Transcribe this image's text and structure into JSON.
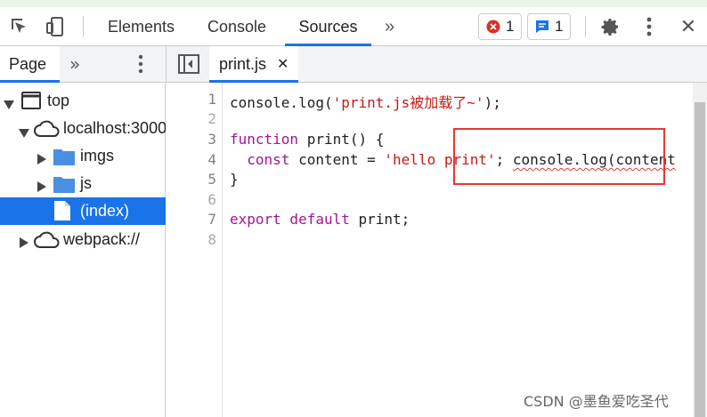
{
  "toolbar": {
    "tabs": [
      "Elements",
      "Console",
      "Sources"
    ],
    "active_tab": "Sources",
    "more_tabs_label": "»",
    "errors_count": "1",
    "messages_count": "1",
    "close_label": "✕"
  },
  "subbar": {
    "page_tab": "Page",
    "more_label": "»",
    "open_file_tab": "print.js",
    "close_file_label": "✕"
  },
  "tree": {
    "items": [
      {
        "label": "top",
        "icon": "window-icon",
        "expanded": true
      },
      {
        "label": "localhost:3000",
        "icon": "cloud-icon",
        "expanded": true
      },
      {
        "label": "imgs",
        "icon": "folder-icon",
        "expanded": false
      },
      {
        "label": "js",
        "icon": "folder-icon",
        "expanded": false
      },
      {
        "label": "(index)",
        "icon": "file-icon",
        "selected": true
      },
      {
        "label": "webpack://",
        "icon": "cloud-icon",
        "expanded": false
      }
    ]
  },
  "editor": {
    "line_numbers": [
      "1",
      "2",
      "3",
      "4",
      "5",
      "6",
      "7",
      "8"
    ],
    "lines": {
      "l1_a": "console.log(",
      "l1_str": "'print.js被加载了~'",
      "l1_b": ");",
      "l3_kw": "function",
      "l3_rest": " print() {",
      "l4_kw": "  const",
      "l4_a": " content = ",
      "l4_str": "'hello print'",
      "l4_b": "; ",
      "l4_err": "console.log(content",
      "l5": "}",
      "l7_kw1": "export",
      "l7_kw2": " default",
      "l7_rest": " print;"
    }
  },
  "watermark": "CSDN @墨鱼爱吃圣代",
  "colors": {
    "accent": "#1a73e8",
    "error": "#d93025",
    "highlight_box": "#e53935",
    "keyword": "#a31495",
    "string": "#1a1aa6"
  }
}
